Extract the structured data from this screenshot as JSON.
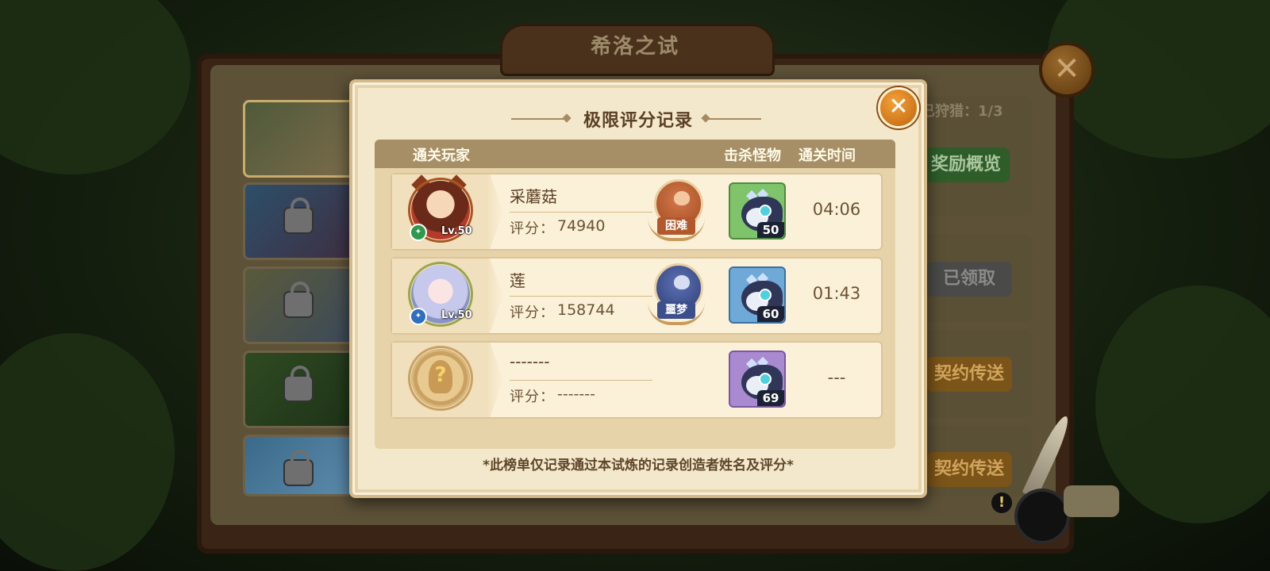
{
  "background": {
    "panel_title": "希洛之试",
    "hunt_counter": "已狩猎：1/3",
    "buttons": {
      "reward_overview": "奖励概览",
      "claimed": "已领取",
      "contract_teleport_1": "契约传送",
      "contract_teleport_2": "契约传送"
    }
  },
  "modal": {
    "title": "极限评分记录",
    "close_glyph": "✕",
    "columns": {
      "player": "通关玩家",
      "kills": "击杀怪物",
      "time": "通关时间"
    },
    "score_label": "评分：",
    "rows": [
      {
        "name": "采蘑菇",
        "score": "74940",
        "level": "Lv.50",
        "difficulty": "困难",
        "difficulty_color": "#b3582c",
        "kills": "50",
        "monster_bg": "#7fc46a",
        "time": "04:06"
      },
      {
        "name": "莲",
        "score": "158744",
        "level": "Lv.50",
        "difficulty": "噩梦",
        "difficulty_color": "#3a4f8c",
        "kills": "60",
        "monster_bg": "#6fa9d8",
        "time": "01:43"
      },
      {
        "name": "-------",
        "score": "-------",
        "level": "",
        "difficulty": "",
        "difficulty_color": "",
        "kills": "69",
        "monster_bg": "#a989cf",
        "time": "---"
      }
    ],
    "footnote": "*此榜单仅记录通过本试炼的记录创造者姓名及评分*"
  },
  "colors": {
    "modal_bg": "#f4e8cc",
    "header_bar": "#a68f66",
    "accent_orange": "#e88a1e"
  }
}
